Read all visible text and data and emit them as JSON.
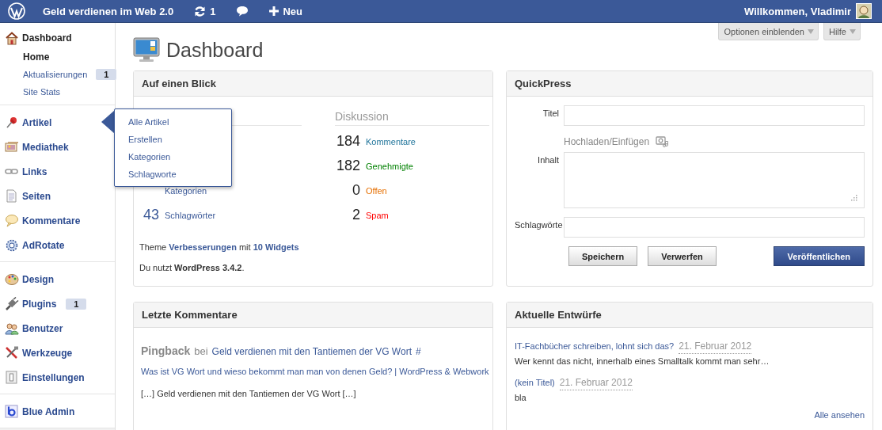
{
  "topbar": {
    "site_title": "Geld verdienen im Web 2.0",
    "updates_count": "1",
    "new_label": "Neu",
    "greeting": "Willkommen, Vladimir"
  },
  "sidebar": {
    "groups": [
      [
        {
          "label": "Dashboard",
          "expanded": true,
          "children": [
            {
              "label": "Home",
              "selected": true
            },
            {
              "label": "Aktualisierungen",
              "selected": false,
              "badge": "1"
            },
            {
              "label": "Site Stats",
              "selected": false
            }
          ]
        }
      ],
      [
        {
          "label": "Artikel",
          "expanded": false,
          "flyout": [
            "Alle Artikel",
            "Erstellen",
            "Kategorien",
            "Schlagworte"
          ]
        },
        {
          "label": "Mediathek",
          "expanded": false
        },
        {
          "label": "Links",
          "expanded": false
        },
        {
          "label": "Seiten",
          "expanded": false
        },
        {
          "label": "Kommentare",
          "expanded": false
        },
        {
          "label": "AdRotate",
          "expanded": false
        }
      ],
      [
        {
          "label": "Design",
          "expanded": false
        },
        {
          "label": "Plugins",
          "expanded": false,
          "badge": "1"
        },
        {
          "label": "Benutzer",
          "expanded": false
        },
        {
          "label": "Werkzeuge",
          "expanded": false
        },
        {
          "label": "Einstellungen",
          "expanded": false
        }
      ],
      [
        {
          "label": "Blue Admin",
          "expanded": false
        }
      ]
    ]
  },
  "screen_buttons": [
    "Optionen einblenden",
    "Hilfe"
  ],
  "page_title": "Dashboard",
  "at_a_glance": {
    "title": "Auf einen Blick",
    "content_rows": [
      {
        "label": "Kategorien"
      },
      {
        "count": "43",
        "label": "Schlagwörter"
      }
    ],
    "discussion_title": "Diskussion",
    "discussion_rows": [
      {
        "count": "184",
        "label": "Kommentare",
        "color": "#21759b"
      },
      {
        "count": "182",
        "label": "Genehmigte",
        "color": "#008000"
      },
      {
        "count": "0",
        "label": "Offen",
        "color": "#e66f00"
      },
      {
        "count": "2",
        "label": "Spam",
        "color": "#ff0000"
      }
    ],
    "theme_line": "Theme **Verbesserungen** mit **10 Widgets**",
    "version_line": "Du nutzt **WordPress 3.4.2**."
  },
  "recent_comments": {
    "title": "Letzte Kommentare",
    "type": "Pingback",
    "by": "bei",
    "post": "Geld verdienen mit den Tantiemen der VG Wort",
    "hash": "#",
    "source": "Was ist VG Wort und wieso bekommt man man von denen Geld? | WordPress & Webwork",
    "excerpt": "[…] Geld verdienen mit den Tantiemen der VG Wort […]"
  },
  "quickpress": {
    "title": "QuickPress",
    "title_label": "Titel",
    "upload_label": "Hochladen/Einfügen",
    "content_label": "Inhalt",
    "tags_label": "Schlagwörte",
    "buttons": [
      "Speichern",
      "Verwerfen",
      "Veröffentlichen"
    ]
  },
  "recent_drafts": {
    "title": "Aktuelle Entwürfe",
    "items": [
      {
        "title": "IT-Fachbücher schreiben, lohnt sich das?",
        "date": "21. Februar 2012",
        "excerpt": "Wer kennt das nicht, innerhalb eines Smalltalk kommt man sehr…"
      },
      {
        "title": "(kein Titel)",
        "date": "21. Februar 2012",
        "excerpt": "bla"
      }
    ],
    "view_all": "Alle ansehen"
  }
}
